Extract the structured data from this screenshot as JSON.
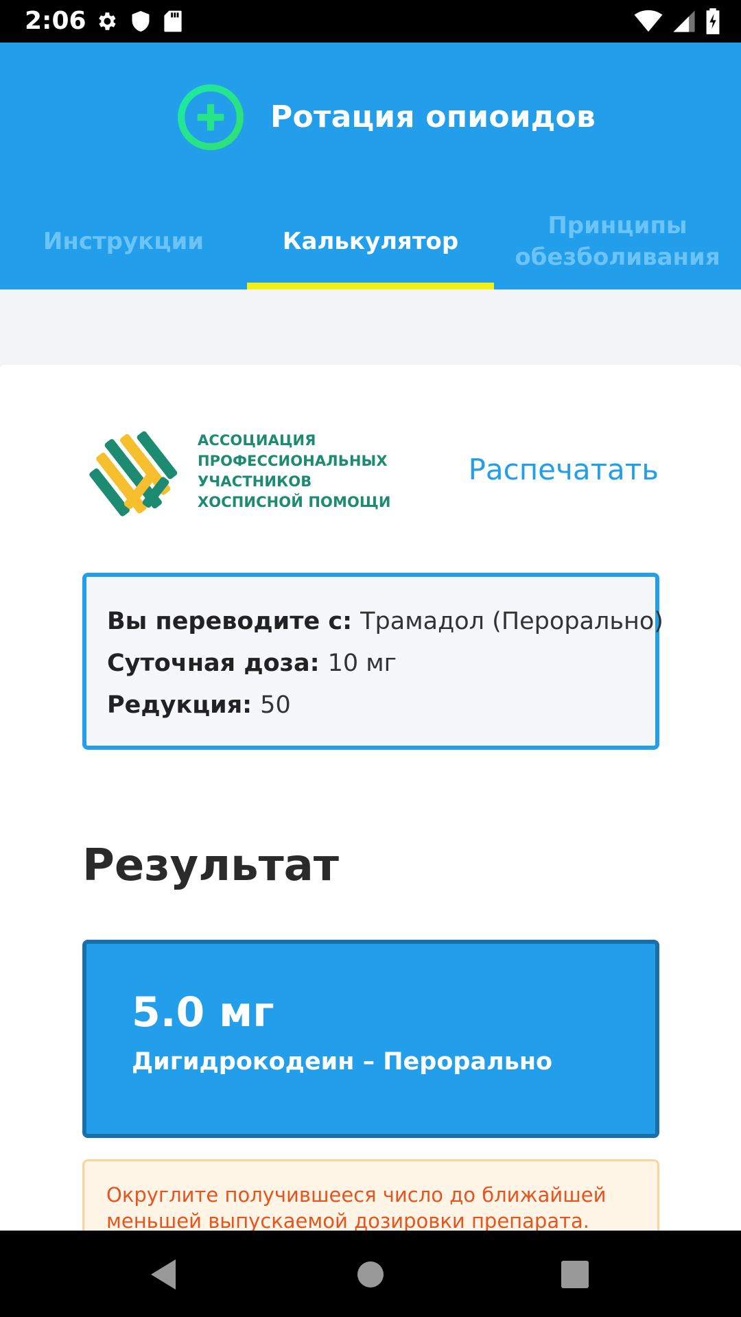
{
  "status_bar": {
    "time": "2:06",
    "icons_left": [
      "settings-icon",
      "shield-icon",
      "sd-card-icon"
    ],
    "icons_right": [
      "wifi-icon",
      "signal-icon",
      "battery-icon"
    ]
  },
  "header": {
    "title": "Ротация опиоидов",
    "logo_icon": "plus-circle-icon",
    "colors": {
      "background": "#239eeb",
      "logo_ring": "#22e88a",
      "tab_indicator": "#f1f019"
    }
  },
  "tabs": [
    {
      "label": "Инструкции",
      "active": false
    },
    {
      "label": "Калькулятор",
      "active": true
    },
    {
      "label": "Принципы обезболивания",
      "active": false
    }
  ],
  "organization": {
    "lines": [
      "АССОЦИАЦИЯ",
      "ПРОФЕССИОНАЛЬНЫХ",
      "УЧАСТНИКОВ",
      "ХОСПИСНОЙ ПОМОЩИ"
    ]
  },
  "print_label": "Распечатать",
  "conversion": {
    "from_label": "Вы переводите с:",
    "from_value": "Трамадол (Перорально)",
    "dose_label": "Суточная доза:",
    "dose_value": "10 мг",
    "reduction_label": "Редукция:",
    "reduction_value": "50"
  },
  "result": {
    "heading": "Результат",
    "dose": "5.0 мг",
    "drug": "Дигидрокодеин – Перорально"
  },
  "warning": {
    "text": "Округлите получившееся число до ближайшей меньшей выпускаемой дозировки препарата."
  },
  "nav_bar": {
    "buttons": [
      "back-icon",
      "home-icon",
      "recents-icon"
    ]
  }
}
